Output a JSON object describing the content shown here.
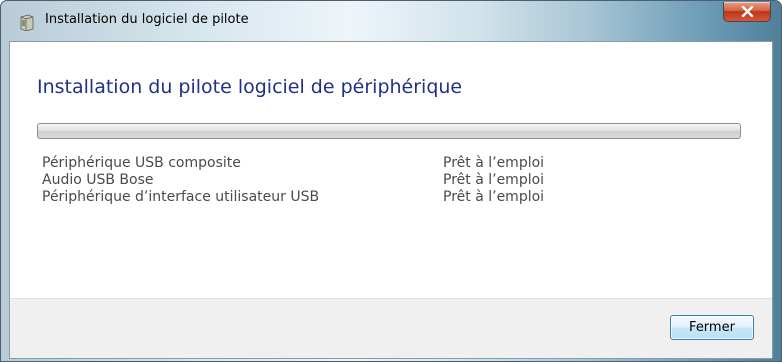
{
  "window": {
    "title": "Installation du logiciel de pilote",
    "icons": {
      "app": "driver-package-icon",
      "close": "close-icon"
    }
  },
  "main": {
    "heading": "Installation du pilote logiciel de périphérique",
    "progress_percent": 0
  },
  "devices": [
    {
      "name": "Périphérique USB composite",
      "status": "Prêt à l’emploi"
    },
    {
      "name": "Audio USB Bose",
      "status": "Prêt à l’emploi"
    },
    {
      "name": "Périphérique d’interface utilisateur USB",
      "status": "Prêt à l’emploi"
    }
  ],
  "footer": {
    "close_label": "Fermer"
  },
  "colors": {
    "heading": "#1e3287",
    "close_button": "#c8472a",
    "accent_button": "#3c7fb1"
  }
}
